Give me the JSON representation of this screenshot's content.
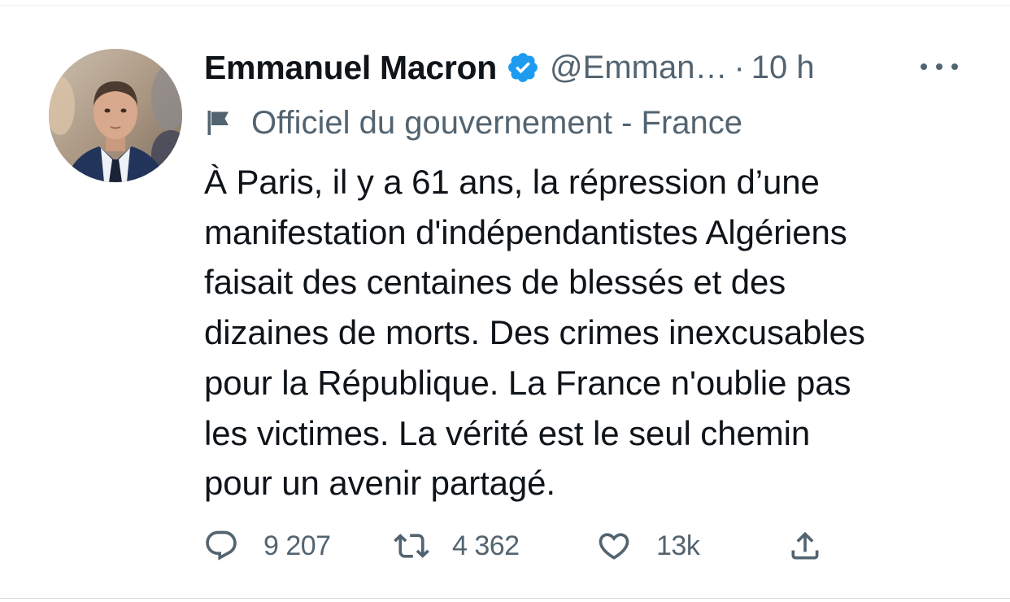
{
  "tweet": {
    "author": {
      "display_name": "Emmanuel Macron",
      "handle": "@Emman…",
      "avatar_icon": "profile-photo",
      "verified_icon": "verified-badge-icon",
      "verified_color": "#1d9bf0"
    },
    "separator": "·",
    "timestamp": "10 h",
    "more_icon": "more-options-icon",
    "label": {
      "icon": "flag-icon",
      "text": "Officiel du gouvernement - France"
    },
    "text": "À Paris, il y a 61 ans, la répression d’une\nmanifestation d'indépendantistes Algériens\nfaisait des centaines de blessés et des\ndizaines de morts. Des crimes inexcusables\npour la République. La France n'oublie pas\nles victimes. La vérité est le seul chemin\npour un avenir partagé.",
    "actions": {
      "reply": {
        "icon": "reply-icon",
        "count": "9 207"
      },
      "retweet": {
        "icon": "retweet-icon",
        "count": "4 362"
      },
      "like": {
        "icon": "heart-icon",
        "count": "13k"
      },
      "share": {
        "icon": "share-icon"
      }
    },
    "colors": {
      "text_primary": "#0f1419",
      "text_secondary": "#536471",
      "accent": "#1d9bf0"
    }
  }
}
